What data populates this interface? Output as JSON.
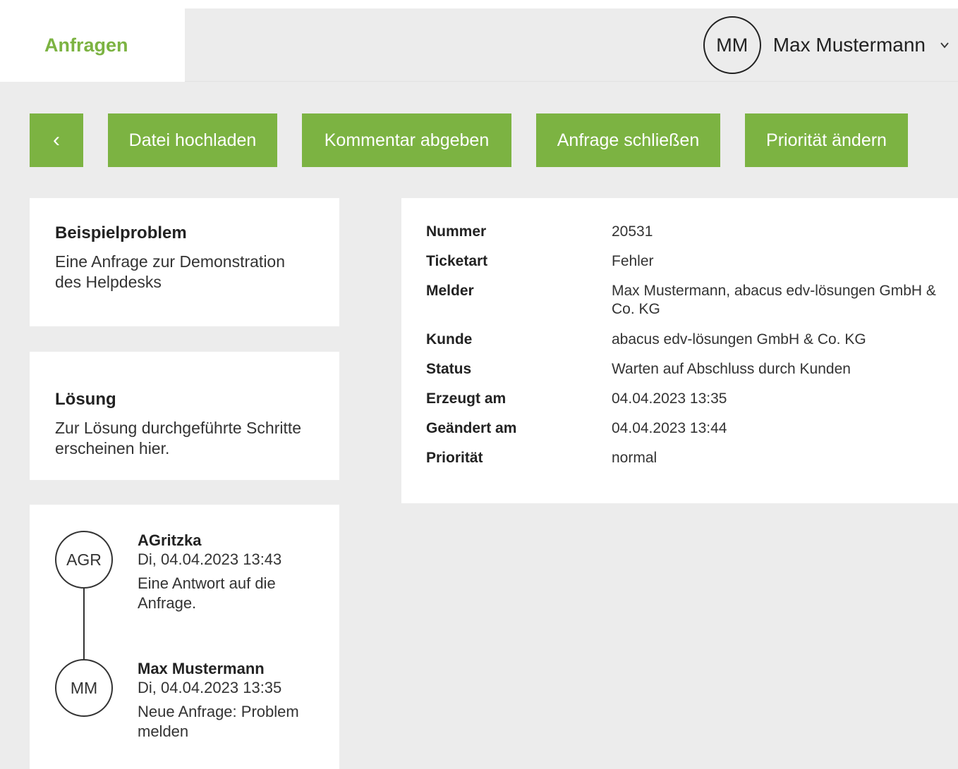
{
  "header": {
    "tab_label": "Anfragen",
    "user_initials": "MM",
    "user_name": "Max Mustermann",
    "menu_icon": "chevron-down-icon"
  },
  "toolbar": {
    "back_label": "‹",
    "upload_label": "Datei hochladen",
    "comment_label": "Kommentar abgeben",
    "close_label": "Anfrage schließen",
    "priority_label": "Priorität ändern"
  },
  "problem": {
    "title": "Beispielproblem",
    "description": "Eine Anfrage zur Demonstration des Helpdesks"
  },
  "solution": {
    "title": "Lösung",
    "description": "Zur Lösung durchgeführte Schritte erscheinen hier."
  },
  "details": [
    {
      "label": "Nummer",
      "value": "20531"
    },
    {
      "label": "Ticketart",
      "value": "Fehler"
    },
    {
      "label": "Melder",
      "value": "Max Mustermann, abacus edv-lösungen GmbH & Co. KG"
    },
    {
      "label": "Kunde",
      "value": "abacus edv-lösungen GmbH & Co. KG"
    },
    {
      "label": "Status",
      "value": "Warten auf Abschluss durch Kunden"
    },
    {
      "label": "Erzeugt am",
      "value": "04.04.2023 13:35"
    },
    {
      "label": "Geändert am",
      "value": "04.04.2023 13:44"
    },
    {
      "label": "Priorität",
      "value": "normal"
    }
  ],
  "timeline": [
    {
      "initials": "AGR",
      "author": "AGritzka",
      "date": "Di, 04.04.2023 13:43",
      "text": "Eine Antwort auf die Anfrage."
    },
    {
      "initials": "MM",
      "author": "Max Mustermann",
      "date": "Di, 04.04.2023 13:35",
      "text": "Neue Anfrage: Problem melden"
    }
  ],
  "colors": {
    "accent": "#7cb342",
    "background": "#ececec",
    "card": "#ffffff"
  }
}
